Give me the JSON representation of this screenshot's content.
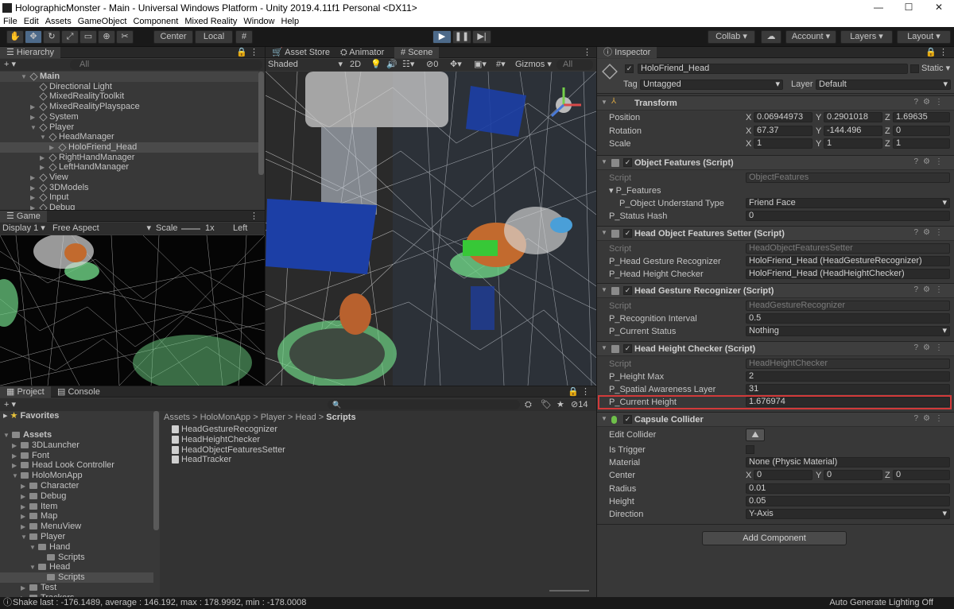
{
  "window": {
    "title": "HolographicMonster - Main - Universal Windows Platform - Unity 2019.4.11f1 Personal <DX11>"
  },
  "menu": [
    "File",
    "Edit",
    "Assets",
    "GameObject",
    "Component",
    "Mixed Reality",
    "Window",
    "Help"
  ],
  "toolbar": {
    "center_label": "Center",
    "local_label": "Local",
    "collab_label": "Collab",
    "account_label": "Account",
    "layers_label": "Layers",
    "layout_label": "Layout"
  },
  "hierarchy": {
    "tab": "Hierarchy",
    "search_placeholder": "All",
    "items": [
      {
        "label": "Main",
        "depth": 0
      },
      {
        "label": "Directional Light",
        "depth": 1
      },
      {
        "label": "MixedRealityToolkit",
        "depth": 1
      },
      {
        "label": "MixedRealityPlayspace",
        "depth": 1
      },
      {
        "label": "System",
        "depth": 1
      },
      {
        "label": "Player",
        "depth": 1
      },
      {
        "label": "HeadManager",
        "depth": 2
      },
      {
        "label": "HoloFriend_Head",
        "depth": 3
      },
      {
        "label": "RightHandManager",
        "depth": 2
      },
      {
        "label": "LeftHandManager",
        "depth": 2
      },
      {
        "label": "View",
        "depth": 1
      },
      {
        "label": "3DModels",
        "depth": 1
      },
      {
        "label": "Input",
        "depth": 1
      },
      {
        "label": "Debug",
        "depth": 1
      }
    ]
  },
  "game": {
    "tab": "Game",
    "display": "Display 1",
    "aspect": "Free Aspect",
    "scale_label": "Scale",
    "scale_value": "1x",
    "extra": "Left Eye"
  },
  "scene": {
    "tabs": [
      "Asset Store",
      "Animator",
      "Scene"
    ],
    "shading": "Shaded",
    "mode2d": "2D",
    "gizmos": "Gizmos",
    "search_placeholder": "All",
    "hidden_count": "0"
  },
  "project": {
    "tabs": [
      "Project",
      "Console"
    ],
    "favorites": "Favorites",
    "hidden_count": "14",
    "breadcrumb": [
      "Assets",
      "HoloMonApp",
      "Player",
      "Head",
      "Scripts"
    ],
    "tree": [
      {
        "label": "Assets",
        "depth": 0
      },
      {
        "label": "3DLauncher",
        "depth": 1
      },
      {
        "label": "Font",
        "depth": 1
      },
      {
        "label": "Head Look Controller",
        "depth": 1
      },
      {
        "label": "HoloMonApp",
        "depth": 1
      },
      {
        "label": "Character",
        "depth": 2
      },
      {
        "label": "Debug",
        "depth": 2
      },
      {
        "label": "Item",
        "depth": 2
      },
      {
        "label": "Map",
        "depth": 2
      },
      {
        "label": "MenuView",
        "depth": 2
      },
      {
        "label": "Player",
        "depth": 2
      },
      {
        "label": "Hand",
        "depth": 3
      },
      {
        "label": "Scripts",
        "depth": 4
      },
      {
        "label": "Head",
        "depth": 3
      },
      {
        "label": "Scripts",
        "depth": 4
      },
      {
        "label": "Test",
        "depth": 2
      },
      {
        "label": "Trackers",
        "depth": 2
      }
    ],
    "files": [
      "HeadGestureRecognizer",
      "HeadHeightChecker",
      "HeadObjectFeaturesSetter",
      "HeadTracker"
    ]
  },
  "inspector": {
    "tab": "Inspector",
    "object_name": "HoloFriend_Head",
    "static_label": "Static",
    "tag_label": "Tag",
    "tag_value": "Untagged",
    "layer_label": "Layer",
    "layer_value": "Default",
    "transform": {
      "title": "Transform",
      "position": {
        "label": "Position",
        "x": "0.06944973",
        "y": "0.2901018",
        "z": "1.69635"
      },
      "rotation": {
        "label": "Rotation",
        "x": "67.37",
        "y": "-144.496",
        "z": "0"
      },
      "scale": {
        "label": "Scale",
        "x": "1",
        "y": "1",
        "z": "1"
      }
    },
    "object_features": {
      "title": "Object Features (Script)",
      "script_label": "Script",
      "script_value": "ObjectFeatures",
      "p_features": "P_Features",
      "understand_label": "P_Object Understand Type",
      "understand_value": "Friend Face",
      "hash_label": "P_Status Hash",
      "hash_value": "0"
    },
    "setter": {
      "title": "Head Object Features Setter (Script)",
      "script_label": "Script",
      "script_value": "HeadObjectFeaturesSetter",
      "gesture_label": "P_Head Gesture Recognizer",
      "gesture_value": "HoloFriend_Head (HeadGestureRecognizer)",
      "height_label": "P_Head Height Checker",
      "height_value": "HoloFriend_Head (HeadHeightChecker)"
    },
    "gesture": {
      "title": "Head Gesture Recognizer (Script)",
      "script_label": "Script",
      "script_value": "HeadGestureRecognizer",
      "interval_label": "P_Recognition Interval",
      "interval_value": "0.5",
      "status_label": "P_Current Status",
      "status_value": "Nothing"
    },
    "height": {
      "title": "Head Height Checker (Script)",
      "script_label": "Script",
      "script_value": "HeadHeightChecker",
      "max_label": "P_Height Max",
      "max_value": "2",
      "layer_label": "P_Spatial Awareness Layer",
      "layer_value": "31",
      "current_label": "P_Current Height",
      "current_value": "1.676974"
    },
    "capsule": {
      "title": "Capsule Collider",
      "edit_label": "Edit Collider",
      "trigger_label": "Is Trigger",
      "material_label": "Material",
      "material_value": "None (Physic Material)",
      "center_label": "Center",
      "cx": "0",
      "cy": "0",
      "cz": "0",
      "radius_label": "Radius",
      "radius_value": "0.01",
      "height_label": "Height",
      "height_value": "0.05",
      "direction_label": "Direction",
      "direction_value": "Y-Axis"
    },
    "add_component": "Add Component"
  },
  "status": {
    "left": "Shake last : -176.1489, average : 146.192, max : 178.9992, min : -178.0008",
    "right": "Auto Generate Lighting Off"
  },
  "colors": {
    "highlight": "#d23a3a",
    "selection": "#2c5d87",
    "play_active": "#4d6a8a"
  }
}
